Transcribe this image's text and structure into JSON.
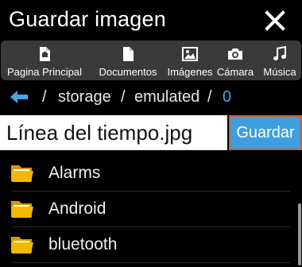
{
  "dialog": {
    "title": "Guardar imagen",
    "close_icon": "close-icon"
  },
  "shortcuts": [
    {
      "label": "Pagina Principal",
      "icon": "home-document-icon"
    },
    {
      "label": "Documentos",
      "icon": "document-icon"
    },
    {
      "label": "Imágenes",
      "icon": "image-icon"
    },
    {
      "label": "Cámara",
      "icon": "camera-icon"
    },
    {
      "label": "Música",
      "icon": "music-note-icon"
    }
  ],
  "path": {
    "back_icon": "arrow-left-icon",
    "sep1": "/",
    "seg1": "storage",
    "sep2": "/",
    "seg2": "emulated",
    "sep3": "/",
    "seg3": "0"
  },
  "filename": {
    "value": "Línea del tiempo.jpg",
    "save_label": "Guardar"
  },
  "folders": [
    {
      "name": "Alarms",
      "icon": "folder-icon"
    },
    {
      "name": "Android",
      "icon": "folder-icon"
    },
    {
      "name": "bluetooth",
      "icon": "folder-icon"
    }
  ],
  "colors": {
    "accent": "#3d9fe0",
    "save_border": "#d85a2a",
    "shortcut_bar": "#3a3a3a",
    "folder": "#f5b800"
  }
}
